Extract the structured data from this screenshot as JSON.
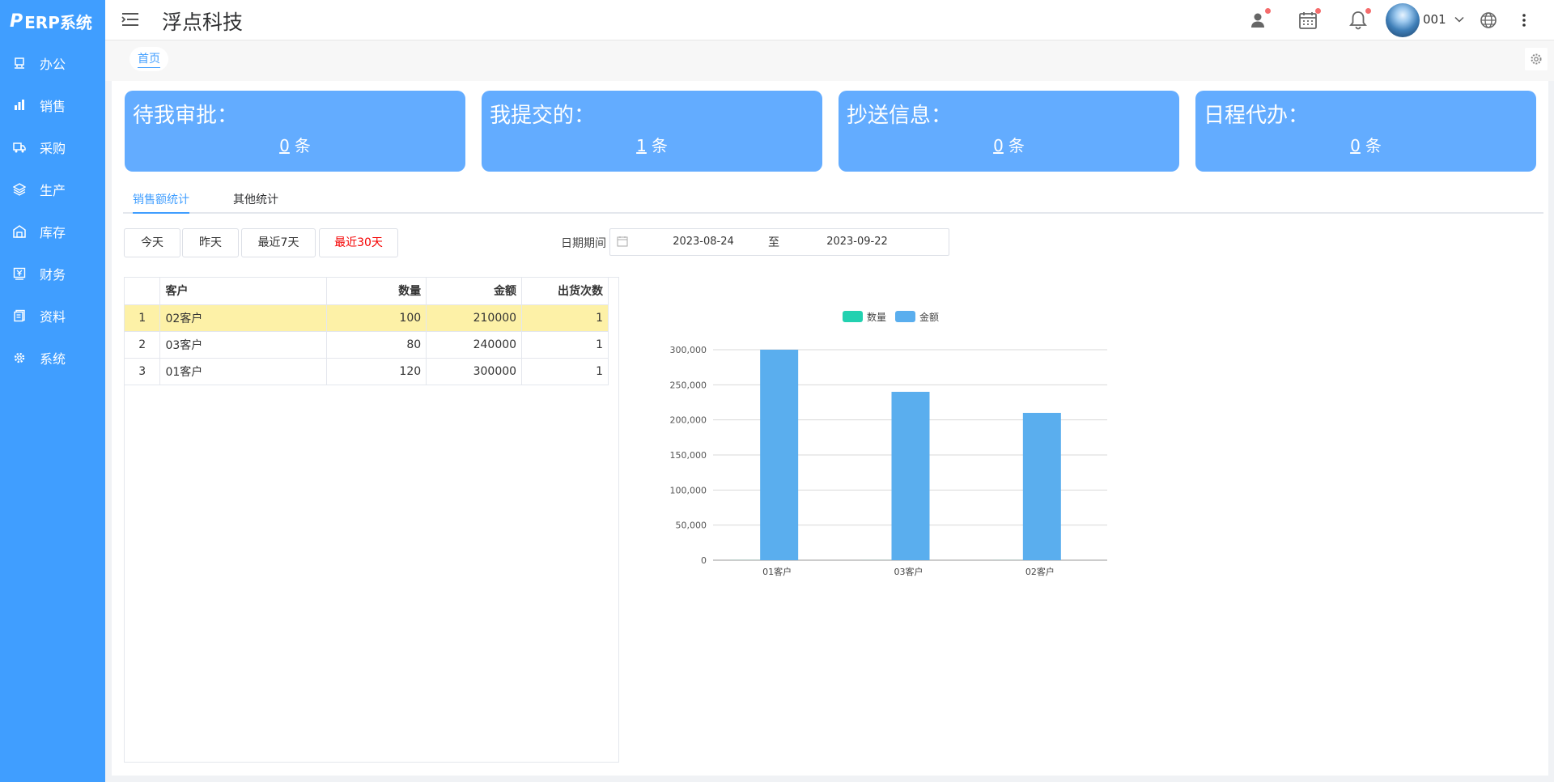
{
  "brand": {
    "logo_char": "P",
    "name": "ERP系统"
  },
  "sidebar": {
    "items": [
      {
        "label": "办公",
        "icon": "office-icon"
      },
      {
        "label": "销售",
        "icon": "bar-chart-icon"
      },
      {
        "label": "采购",
        "icon": "truck-icon"
      },
      {
        "label": "生产",
        "icon": "layers-icon"
      },
      {
        "label": "库存",
        "icon": "warehouse-icon"
      },
      {
        "label": "财务",
        "icon": "finance-icon"
      },
      {
        "label": "资料",
        "icon": "document-icon"
      },
      {
        "label": "系统",
        "icon": "settings-gear-icon"
      }
    ]
  },
  "header": {
    "company": "浮点科技",
    "username": "001"
  },
  "tags": {
    "home": "首页"
  },
  "cards": [
    {
      "title": "待我审批：",
      "count": "0",
      "unit": "条"
    },
    {
      "title": "我提交的：",
      "count": "1",
      "unit": "条"
    },
    {
      "title": "抄送信息：",
      "count": "0",
      "unit": "条"
    },
    {
      "title": "日程代办：",
      "count": "0",
      "unit": "条"
    }
  ],
  "tabs": {
    "sales": "销售额统计",
    "other": "其他统计"
  },
  "quick": {
    "today": "今天",
    "yesterday": "昨天",
    "last7": "最近7天",
    "last30": "最近30天"
  },
  "date": {
    "label": "日期期间",
    "start": "2023-08-24",
    "sep": "至",
    "end": "2023-09-22"
  },
  "table": {
    "headers": [
      "",
      "客户",
      "数量",
      "金额",
      "出货次数"
    ],
    "rows": [
      [
        "1",
        "02客户",
        "100",
        "210000",
        "1"
      ],
      [
        "2",
        "03客户",
        "80",
        "240000",
        "1"
      ],
      [
        "3",
        "01客户",
        "120",
        "300000",
        "1"
      ]
    ]
  },
  "colors": {
    "sidebar": "#409eff",
    "card": "#63acff",
    "qty": "#22d1b0",
    "amount": "#5aaeee",
    "highlight": "#fdf1a7"
  },
  "chart_data": {
    "type": "bar",
    "categories": [
      "01客户",
      "03客户",
      "02客户"
    ],
    "series": [
      {
        "name": "数量",
        "values": [
          120,
          80,
          100
        ]
      },
      {
        "name": "金额",
        "values": [
          300000,
          240000,
          210000
        ]
      }
    ],
    "ylim": [
      0,
      300000
    ],
    "yticks": [
      "0",
      "50,000",
      "100,000",
      "150,000",
      "200,000",
      "250,000",
      "300,000"
    ],
    "grid": true,
    "legend": "top-center"
  }
}
